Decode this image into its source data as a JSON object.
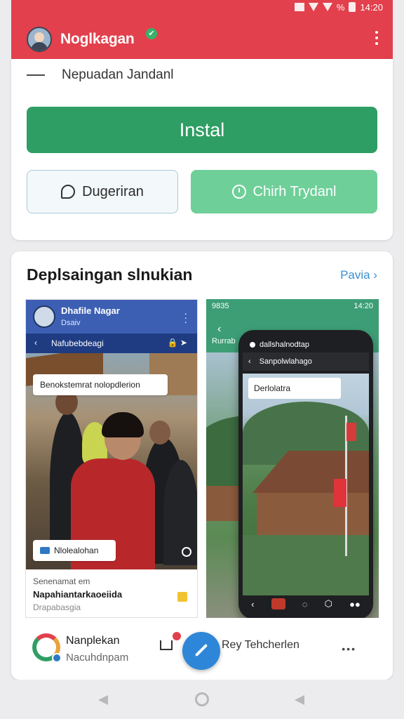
{
  "status_bar": {
    "time": "14:20",
    "battery": "%"
  },
  "header": {
    "app_title": "Noglkagan",
    "verified_mark": "✔"
  },
  "install_card": {
    "subtitle": "Nepuadan Jandanl",
    "install_label": "Instal",
    "secondary_label": "Dugeriran",
    "tertiary_label": "Chirh Trydanl"
  },
  "screenshots": {
    "title": "Deplsaingan slnukian",
    "more_label": "Pavia",
    "left": {
      "app_name": "Dhafile Nagar",
      "app_sub": "Dsaiv",
      "nav_text": "Nafubebdeagi",
      "label_top": "Benokstemrat nolopdlerion",
      "label_bottom": "Nlolealohan",
      "footer_a": "Senenamat em",
      "footer_b": "Napahiantarkaoeiida",
      "footer_c": "Drapabasgia"
    },
    "right": {
      "status_left": "9835",
      "status_right": "14:20",
      "small_label": "Rurrab",
      "phone_top": "dallshalnodtap",
      "phone_nav": "Sanpolwlahago",
      "phone_label": "Derlolatra"
    }
  },
  "bottom": {
    "dev_name": "Nanplekan",
    "dev_sub": "Nacuhdnpam",
    "review_label": "Rey Tehcherlen",
    "more_dots": "•••"
  },
  "colors": {
    "header_red": "#e2404c",
    "install_green": "#2f9e64",
    "soft_green": "#6ecf98",
    "fab_blue": "#2e86d8"
  }
}
